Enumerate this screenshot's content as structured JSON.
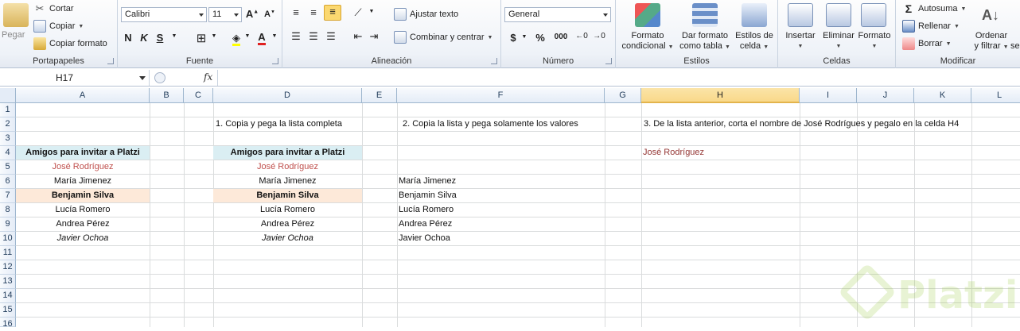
{
  "ribbon": {
    "clipboard": {
      "label": "Portapapeles",
      "paste": "Pegar",
      "cut": "Cortar",
      "copy": "Copiar",
      "format_painter": "Copiar formato"
    },
    "font": {
      "label": "Fuente",
      "font_name": "Calibri",
      "font_size": "11",
      "bold": "N",
      "italic": "K",
      "underline": "S"
    },
    "alignment": {
      "label": "Alineación",
      "wrap_text": "Ajustar texto",
      "merge_center": "Combinar y centrar"
    },
    "number": {
      "label": "Número",
      "format": "General",
      "currency": "$",
      "percent": "%",
      "thousands": "000"
    },
    "styles": {
      "label": "Estilos",
      "conditional_line1": "Formato",
      "conditional_line2": "condicional",
      "table_line1": "Dar formato",
      "table_line2": "como tabla",
      "cell_styles_line1": "Estilos de",
      "cell_styles_line2": "celda"
    },
    "cells": {
      "label": "Celdas",
      "insert": "Insertar",
      "delete": "Eliminar",
      "format": "Formato"
    },
    "editing": {
      "label": "Modificar",
      "autosum": "Autosuma",
      "fill": "Rellenar",
      "clear": "Borrar",
      "sort_line1": "Ordenar",
      "sort_line2": "y filtrar",
      "find_partial": "se"
    }
  },
  "formula_bar": {
    "name_box": "H17",
    "fx": "fx",
    "formula": ""
  },
  "columns": [
    "A",
    "B",
    "C",
    "D",
    "E",
    "F",
    "G",
    "H",
    "I",
    "J",
    "K",
    "L"
  ],
  "rows": [
    "1",
    "2",
    "3",
    "4",
    "5",
    "6",
    "7",
    "8",
    "9",
    "10",
    "11",
    "12",
    "13",
    "14",
    "15",
    "16"
  ],
  "cells": {
    "D2": "1. Copia y pega la lista completa",
    "F2": "2. Copia la lista y pega solamente los valores",
    "H2": "3. De la lista anterior, corta el nombre de José Rodrígues y pegalo en la celda H4",
    "A4": "Amigos para invitar a Platzi",
    "D4": "Amigos para invitar a Platzi",
    "H4": "José Rodríguez",
    "A5": "José Rodríguez",
    "D5": "José Rodríguez",
    "A6": "María Jimenez",
    "D6": "María Jimenez",
    "F6": "María Jimenez",
    "A7": "Benjamin Silva",
    "D7": "Benjamin Silva",
    "F7": "Benjamin Silva",
    "A8": "Lucía Romero",
    "D8": "Lucía Romero",
    "F8": "Lucía Romero",
    "A9": "Andrea Pérez",
    "D9": "Andrea Pérez",
    "F9": "Andrea Pérez",
    "A10": "Javier Ochoa",
    "D10": "Javier Ochoa",
    "F10": "Javier Ochoa"
  },
  "colors": {
    "header_fill": "#daeef3",
    "highlight_fill": "#fde9d9",
    "name_red": "#c0504d",
    "selected_col": "#f9d98a"
  },
  "watermark": {
    "text": "Platzi"
  }
}
